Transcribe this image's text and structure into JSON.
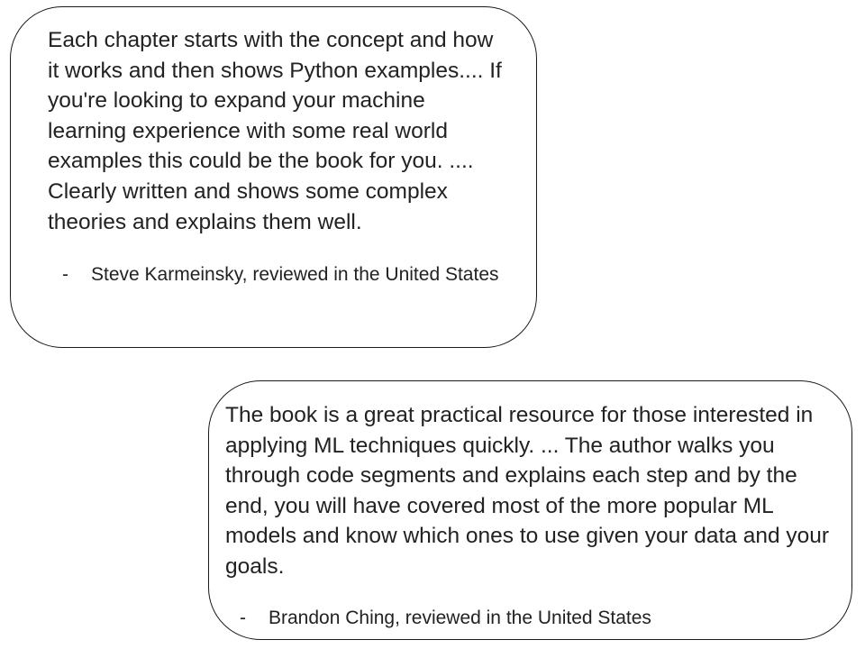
{
  "reviews": [
    {
      "quote": "Each chapter starts with the concept and how it works and then shows Python examples.... If you're looking to expand your machine learning experience with some real world examples this could be the book for you. .... Clearly written and shows some complex theories and explains them well.",
      "dash": "-",
      "attribution": "Steve Karmeinsky, reviewed in the United States"
    },
    {
      "quote": "The book is a great practical resource for those interested in applying ML techniques quickly. ... The author walks you through code segments and explains each step and by the end, you will have covered most of the more popular ML models and know which ones to use given your data and your goals.",
      "dash": "-",
      "attribution": "Brandon Ching, reviewed in the United States"
    }
  ]
}
